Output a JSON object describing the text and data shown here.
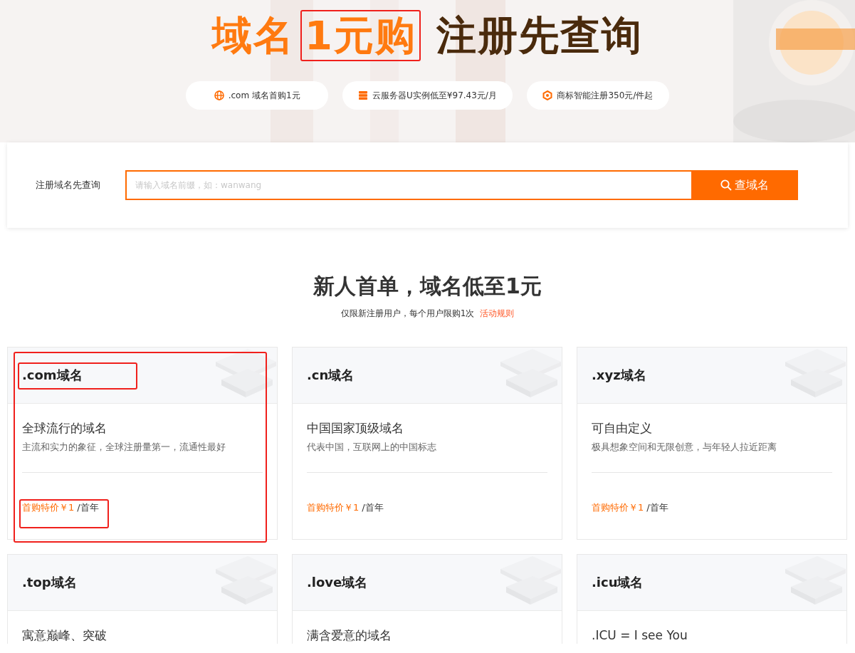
{
  "hero": {
    "headline": [
      {
        "text": "域名",
        "kind": "accent",
        "marked": false
      },
      {
        "text": "1元购",
        "kind": "accent",
        "marked": true
      },
      {
        "text": "注册先查询",
        "kind": "dark",
        "marked": false
      }
    ],
    "pills": [
      {
        "kind": "globe",
        "label": ".com 域名首购1元"
      },
      {
        "kind": "server",
        "label": "云服务器U实例低至¥97.43元/月"
      },
      {
        "kind": "hexagon",
        "label": "商标智能注册350元/件起"
      }
    ]
  },
  "search": {
    "label": "注册域名先查询",
    "placeholder": "请输入域名前缀，如：wanwang",
    "button": "查域名"
  },
  "offer": {
    "title": "新人首单，域名低至1元",
    "note": "仅限新注册用户，每个用户限购1次",
    "rules_link": "活动规则"
  },
  "cards": [
    {
      "title": ".com域名",
      "subtitle": "全球流行的域名",
      "description": "主流和实力的象征，全球注册量第一，流通性最好",
      "price_label": "首购特价￥1",
      "price_unit": "/首年",
      "marked": true
    },
    {
      "title": ".cn域名",
      "subtitle": "中国国家顶级域名",
      "description": "代表中国，互联网上的中国标志",
      "price_label": "首购特价￥1",
      "price_unit": "/首年",
      "marked": false
    },
    {
      "title": ".xyz域名",
      "subtitle": "可自由定义",
      "description": "极具想象空间和无限创意，与年轻人拉近距离",
      "price_label": "首购特价￥1",
      "price_unit": "/首年",
      "marked": false
    },
    {
      "title": ".top域名",
      "subtitle": "寓意巅峰、突破",
      "marked": false
    },
    {
      "title": ".love域名",
      "subtitle": "满含爱意的域名",
      "marked": false
    },
    {
      "title": ".icu域名",
      "subtitle": ".ICU = I see You",
      "marked": false
    }
  ]
}
